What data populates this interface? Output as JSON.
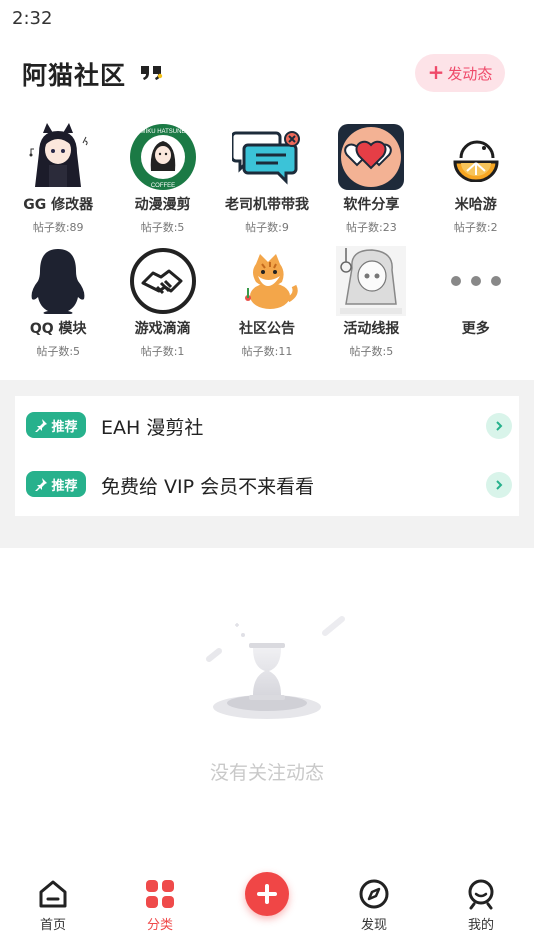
{
  "status_bar": {
    "time": "2:32"
  },
  "header": {
    "title": "阿猫社区",
    "post_button_label": "发动态",
    "post_button_plus": "+"
  },
  "forums": [
    {
      "name": "GG 修改器",
      "count": "帖子数:89",
      "icon": "anime-girl-icon"
    },
    {
      "name": "动漫漫剪",
      "count": "帖子数:5",
      "icon": "miku-coffee-logo-icon"
    },
    {
      "name": "老司机带带我",
      "count": "帖子数:9",
      "icon": "chat-bubbles-icon"
    },
    {
      "name": "软件分享",
      "count": "帖子数:23",
      "icon": "hearts-icon"
    },
    {
      "name": "米哈游",
      "count": "帖子数:2",
      "icon": "orange-slice-icon"
    },
    {
      "name": "QQ 模块",
      "count": "帖子数:5",
      "icon": "qq-penguin-icon"
    },
    {
      "name": "游戏滴滴",
      "count": "帖子数:1",
      "icon": "handshake-icon"
    },
    {
      "name": "社区公告",
      "count": "帖子数:11",
      "icon": "cat-icon"
    },
    {
      "name": "活动线报",
      "count": "帖子数:5",
      "icon": "anime-sketch-icon"
    },
    {
      "name": "更多",
      "count": "",
      "icon": "more-dots-icon"
    }
  ],
  "recommendations": [
    {
      "tag": "推荐",
      "title": "EAH 漫剪社"
    },
    {
      "tag": "推荐",
      "title": "免费给 VIP 会员不来看看"
    }
  ],
  "empty_state": {
    "text": "没有关注动态"
  },
  "tabbar": [
    {
      "label": "首页",
      "icon": "home-icon"
    },
    {
      "label": "分类",
      "icon": "category-icon"
    },
    {
      "label": "",
      "icon": "plus-icon"
    },
    {
      "label": "发现",
      "icon": "compass-icon"
    },
    {
      "label": "我的",
      "icon": "profile-icon"
    }
  ],
  "colors": {
    "accent": "#ef4a4a",
    "recommend": "#27b18c",
    "post_button_bg": "#fde3e8"
  }
}
